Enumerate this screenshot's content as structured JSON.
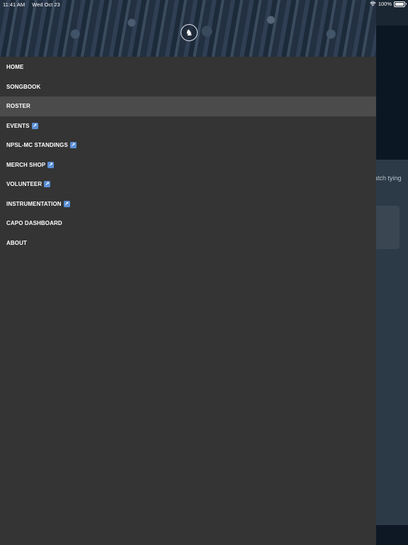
{
  "status_bar": {
    "time": "11:41 AM",
    "date": "Wed Oct 23",
    "battery_percent": "100%",
    "battery_level": 1.0
  },
  "background": {
    "partial_text": "atch tying"
  },
  "drawer": {
    "menu_items": [
      {
        "label": "HOME",
        "external": false
      },
      {
        "label": "SONGBOOK",
        "external": false
      },
      {
        "label": "ROSTER",
        "external": false,
        "active": true
      },
      {
        "label": "EVENTS",
        "external": true
      },
      {
        "label": "NPSL-MC STANDINGS",
        "external": true
      },
      {
        "label": "MERCH SHOP",
        "external": true
      },
      {
        "label": "VOLUNTEER",
        "external": true
      },
      {
        "label": "INSTRUMENTATION",
        "external": true
      },
      {
        "label": "CAPO DASHBOARD",
        "external": false
      },
      {
        "label": "ABOUT",
        "external": false
      }
    ],
    "external_icon": "external-link-icon",
    "external_glyph": "↗"
  },
  "colors": {
    "drawer_bg": "#343434",
    "active_item_bg": "#4b4b4b",
    "external_icon_bg": "#5b8fd6"
  }
}
